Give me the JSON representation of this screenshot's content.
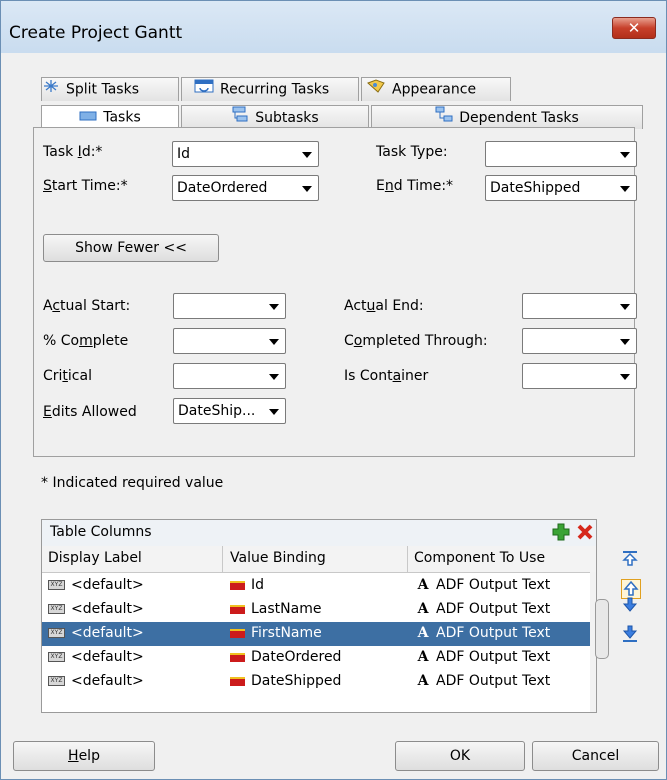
{
  "window": {
    "title": "Create Project Gantt",
    "close_glyph": "✕"
  },
  "tabs": {
    "row1": [
      {
        "label": "Split Tasks"
      },
      {
        "label": "Recurring Tasks"
      },
      {
        "label": "Appearance"
      }
    ],
    "row2": [
      {
        "label": "Tasks"
      },
      {
        "label": "Subtasks"
      },
      {
        "label": "Dependent Tasks"
      }
    ]
  },
  "fields": {
    "task_id": {
      "label_pre": "Task ",
      "label_u": "I",
      "label_post": "d:*",
      "value": "Id"
    },
    "task_type": {
      "label": "Task Type:",
      "value": ""
    },
    "start_time": {
      "label_u": "S",
      "label_post": "tart Time:*",
      "value": "DateOrdered"
    },
    "end_time": {
      "label_pre": "E",
      "label_u": "n",
      "label_post": "d Time:*",
      "value": "DateShipped"
    },
    "show_fewer": "Show Fewer <<",
    "actual_start": {
      "label_pre": "A",
      "label_u": "c",
      "label_post": "tual Start:",
      "value": ""
    },
    "actual_end": {
      "label_pre": "Act",
      "label_u": "u",
      "label_post": "al End:",
      "value": ""
    },
    "pct_complete": {
      "label_pre": "% Co",
      "label_u": "m",
      "label_post": "plete",
      "value": ""
    },
    "completed_through": {
      "label_pre": "C",
      "label_u": "o",
      "label_post": "mpleted Through:",
      "value": ""
    },
    "critical": {
      "label_pre": "Cri",
      "label_u": "t",
      "label_post": "ical",
      "value": ""
    },
    "is_container": {
      "label_pre": "Is Cont",
      "label_u": "a",
      "label_post": "iner",
      "value": ""
    },
    "edits_allowed": {
      "label_u": "E",
      "label_post": "dits Allowed",
      "value": "DateShip..."
    }
  },
  "required_note": "* Indicated required value",
  "table": {
    "title": "Table Columns",
    "headers": [
      "Display Label",
      "Value Binding",
      "Component To Use"
    ],
    "rows": [
      {
        "label": "<default>",
        "binding": "Id",
        "component": "ADF Output Text"
      },
      {
        "label": "<default>",
        "binding": "LastName",
        "component": "ADF Output Text"
      },
      {
        "label": "<default>",
        "binding": "FirstName",
        "component": "ADF Output Text"
      },
      {
        "label": "<default>",
        "binding": "DateOrdered",
        "component": "ADF Output Text"
      },
      {
        "label": "<default>",
        "binding": "DateShipped",
        "component": "ADF Output Text"
      }
    ],
    "selected_row": 2,
    "icon_text": "XYZ"
  },
  "buttons": {
    "help_u": "H",
    "help_rest": "elp",
    "ok": "OK",
    "cancel": "Cancel"
  },
  "colors": {
    "selection": "#3d6fa3",
    "add": "#3aa335",
    "delete": "#d6281b",
    "arrows": "#2f6fc2"
  }
}
